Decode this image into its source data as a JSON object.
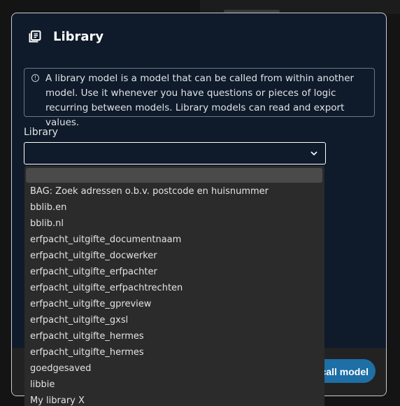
{
  "dialog": {
    "title": "Library",
    "icon": "library-icon",
    "info_icon": "info-icon",
    "info_text": "A library model is a model that can be called from within another model. Use it whenever you have questions or pieces of logic recurring between models. Library models can read and export values.",
    "field_label": "Library",
    "select_value": "",
    "primary_button_label": "Add call model"
  },
  "dropdown": {
    "options": [
      "",
      "BAG: Zoek adressen o.b.v. postcode en huisnummer",
      "bblib.en",
      "bblib.nl",
      "erfpacht_uitgifte_documentnaam",
      "erfpacht_uitgifte_docwerker",
      "erfpacht_uitgifte_erfpachter",
      "erfpacht_uitgifte_erfpachtrechten",
      "erfpacht_uitgifte_gpreview",
      "erfpacht_uitgifte_gxsl",
      "erfpacht_uitgifte_hermes",
      "erfpacht_uitgifte_hermes",
      "goedgesaved",
      "libbie",
      "My library X"
    ]
  }
}
